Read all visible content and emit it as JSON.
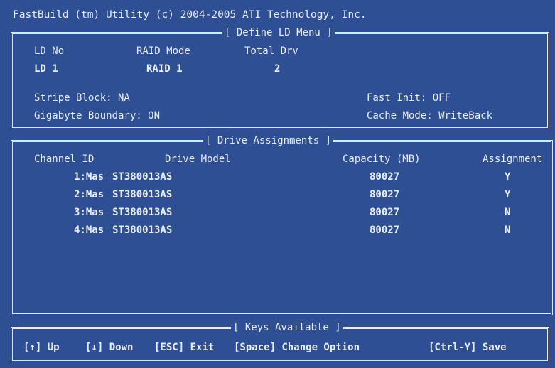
{
  "header": {
    "title": "FastBuild (tm) Utility (c) 2004-2005 ATI Technology, Inc."
  },
  "define_ld": {
    "section_title": "[ Define LD Menu ]",
    "col_ld_no": "LD No",
    "col_raid_mode": "RAID Mode",
    "col_total_drv": "Total Drv",
    "ld_no": "LD 1",
    "raid_mode": "RAID 1",
    "total_drv": "2",
    "stripe_block": "Stripe Block: NA",
    "gigabyte_boundary": "Gigabyte Boundary: ON",
    "fast_init": "Fast Init: OFF",
    "cache_mode": "Cache Mode: WriteBack"
  },
  "drive_assignments": {
    "section_title": "[ Drive Assignments ]",
    "headers": {
      "channel_id": "Channel ID",
      "drive_model": "Drive Model",
      "capacity": "Capacity (MB)",
      "assignment": "Assignment"
    },
    "rows": [
      {
        "channel": "1:Mas",
        "model": "ST380013AS",
        "capacity": "80027",
        "assignment": "Y"
      },
      {
        "channel": "2:Mas",
        "model": "ST380013AS",
        "capacity": "80027",
        "assignment": "Y"
      },
      {
        "channel": "3:Mas",
        "model": "ST380013AS",
        "capacity": "80027",
        "assignment": "N"
      },
      {
        "channel": "4:Mas",
        "model": "ST380013AS",
        "capacity": "80027",
        "assignment": "N"
      }
    ]
  },
  "keys": {
    "section_title": "[ Keys Available ]",
    "up": "[↑] Up",
    "down": "[↓] Down",
    "exit": "[ESC] Exit",
    "change": "[Space] Change Option",
    "save": "[Ctrl-Y] Save"
  },
  "colors": {
    "background": "#2e4f93",
    "foreground": "#e9edf6",
    "border": "#e6eaf4"
  }
}
